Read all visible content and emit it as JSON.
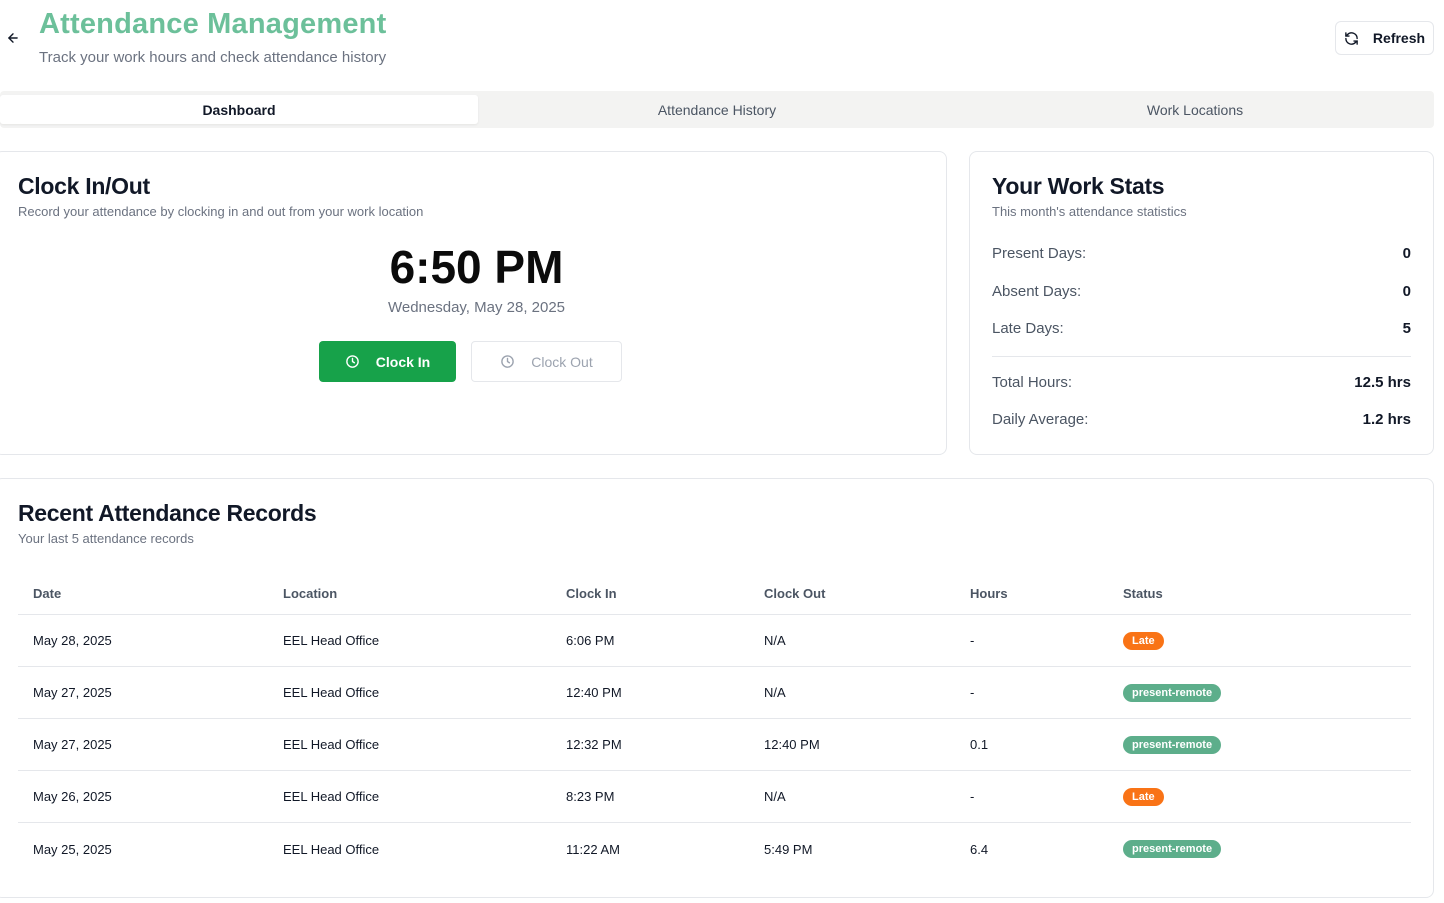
{
  "header": {
    "title": "Attendance Management",
    "subtitle": "Track your work hours and check attendance history",
    "refresh_label": "Refresh",
    "title_color": "#6cc09a"
  },
  "tabs": [
    {
      "label": "Dashboard",
      "active": true
    },
    {
      "label": "Attendance History",
      "active": false
    },
    {
      "label": "Work Locations",
      "active": false
    }
  ],
  "clock": {
    "title": "Clock In/Out",
    "description": "Record your attendance by clocking in and out from your work location",
    "time": "6:50 PM",
    "date": "Wednesday, May 28, 2025",
    "clock_in_label": "Clock In",
    "clock_out_label": "Clock Out",
    "clock_in_color": "#17a24a"
  },
  "stats": {
    "title": "Your Work Stats",
    "description": "This month's attendance statistics",
    "rows": [
      {
        "label": "Present Days:",
        "value": "0"
      },
      {
        "label": "Absent Days:",
        "value": "0"
      },
      {
        "label": "Late Days:",
        "value": "5"
      },
      {
        "label": "Total Hours:",
        "value": "12.5 hrs"
      },
      {
        "label": "Daily Average:",
        "value": "1.2 hrs"
      }
    ]
  },
  "records": {
    "title": "Recent Attendance Records",
    "description": "Your last 5 attendance records",
    "columns": [
      "Date",
      "Location",
      "Clock In",
      "Clock Out",
      "Hours",
      "Status"
    ],
    "rows": [
      {
        "date": "May 28, 2025",
        "location": "EEL Head Office",
        "clock_in": "6:06 PM",
        "clock_out": "N/A",
        "hours": "-",
        "status": "Late"
      },
      {
        "date": "May 27, 2025",
        "location": "EEL Head Office",
        "clock_in": "12:40 PM",
        "clock_out": "N/A",
        "hours": "-",
        "status": "present-remote"
      },
      {
        "date": "May 27, 2025",
        "location": "EEL Head Office",
        "clock_in": "12:32 PM",
        "clock_out": "12:40 PM",
        "hours": "0.1",
        "status": "present-remote"
      },
      {
        "date": "May 26, 2025",
        "location": "EEL Head Office",
        "clock_in": "8:23 PM",
        "clock_out": "N/A",
        "hours": "-",
        "status": "Late"
      },
      {
        "date": "May 25, 2025",
        "location": "EEL Head Office",
        "clock_in": "11:22 AM",
        "clock_out": "5:49 PM",
        "hours": "6.4",
        "status": "present-remote"
      }
    ],
    "status_colors": {
      "Late": "#f97316",
      "present-remote": "#5dae8b"
    }
  },
  "icons": {
    "back": "arrow-left-icon",
    "refresh": "refresh-icon",
    "clock": "clock-icon"
  }
}
